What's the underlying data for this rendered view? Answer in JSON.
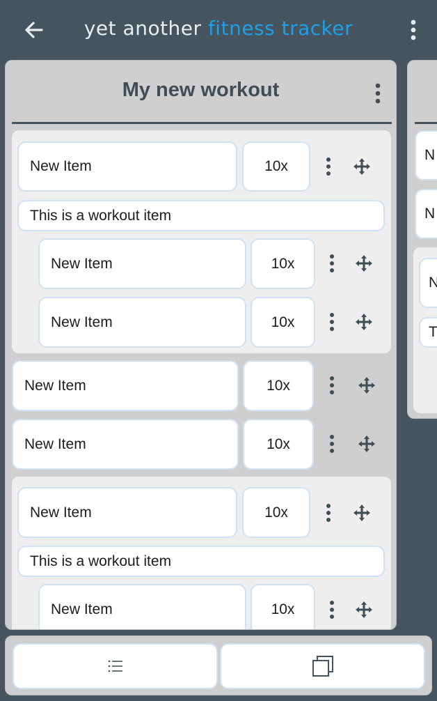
{
  "appbar": {
    "title_part1": "yet another",
    "title_part2": "fitness tracker",
    "accent_color": "#1ea0e6",
    "back_icon": "arrow-left-icon",
    "menu_icon": "more-vertical-icon"
  },
  "workout": {
    "title": "My new workout",
    "menu_icon": "more-vertical-icon",
    "rows": [
      {
        "name": "New Item",
        "reps": "10x"
      },
      {
        "description": "This is a workout item"
      },
      {
        "name": "New Item",
        "reps": "10x"
      },
      {
        "name": "New Item",
        "reps": "10x"
      },
      {
        "name": "New Item",
        "reps": "10x"
      },
      {
        "name": "New Item",
        "reps": "10x"
      },
      {
        "name": "New Item",
        "reps": "10x"
      },
      {
        "description": "This is a workout item"
      },
      {
        "name": "New Item",
        "reps": "10x"
      }
    ]
  },
  "peek_card": {
    "rows": [
      "N",
      "N",
      "N",
      "T"
    ]
  },
  "bottom_bar": {
    "list_icon": "list-icon",
    "duplicate_icon": "copy-icon"
  }
}
